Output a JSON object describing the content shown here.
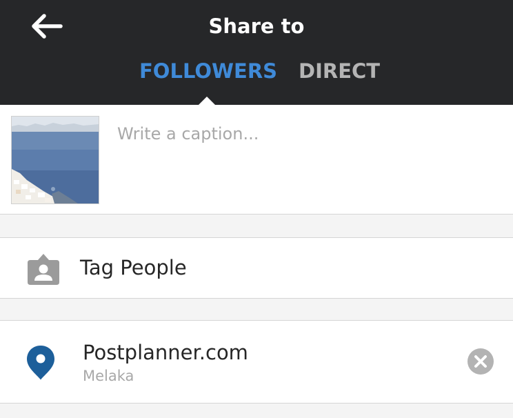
{
  "header": {
    "title": "Share to",
    "back_icon": "arrow-left-icon",
    "tabs": [
      {
        "label": "FOLLOWERS",
        "active": true
      },
      {
        "label": "DIRECT",
        "active": false
      }
    ]
  },
  "compose": {
    "caption_value": "",
    "caption_placeholder": "Write a caption..."
  },
  "tag_people": {
    "icon": "tag-person-icon",
    "label": "Tag People"
  },
  "location": {
    "icon": "location-pin-icon",
    "name": "Postplanner.com",
    "subtitle": "Melaka",
    "clear_icon": "clear-circle-icon"
  },
  "colors": {
    "header_bg": "#262729",
    "active_tab": "#3f8ad8",
    "inactive_tab": "#b4b4b4",
    "pin": "#1d5f9a",
    "icon_gray": "#9b9b9b"
  }
}
